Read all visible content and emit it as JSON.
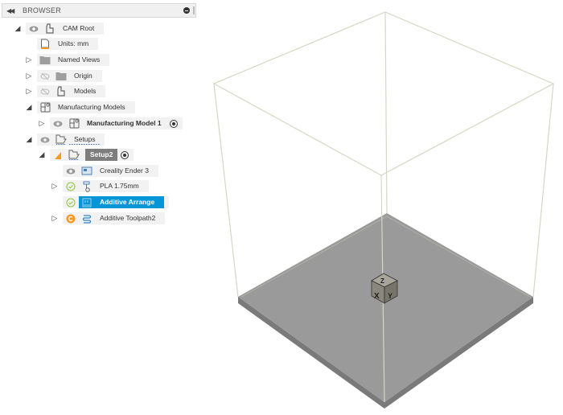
{
  "browser": {
    "title": "BROWSER",
    "collapse_icon": "double-chevron-left-icon",
    "tree": [
      {
        "label": "CAM Root",
        "expand": "expanded",
        "visibility": "visible",
        "icon": "component-icon"
      },
      {
        "label": "Units: mm",
        "expand": "none",
        "icon": "document-icon"
      },
      {
        "label": "Named Views",
        "expand": "collapsed",
        "icon": "folder-icon"
      },
      {
        "label": "Origin",
        "expand": "collapsed",
        "visibility": "hidden",
        "icon": "folder-icon"
      },
      {
        "label": "Models",
        "expand": "collapsed",
        "visibility": "hidden",
        "icon": "component-icon"
      },
      {
        "label": "Manufacturing Models",
        "expand": "expanded",
        "icon": "manufacturing-model-icon"
      },
      {
        "label": "Manufacturing Model 1",
        "expand": "collapsed",
        "visibility": "visible",
        "icon": "manufacturing-model-icon",
        "active": true
      },
      {
        "label": "Setups",
        "expand": "expanded",
        "visibility": "visible",
        "icon": "setups-icon"
      },
      {
        "label": "Setup2",
        "expand": "expanded",
        "icon": "setup-icon",
        "warning": true,
        "active": true
      },
      {
        "label": "Creality Ender 3",
        "expand": "none",
        "visibility": "visible",
        "icon": "machine-icon"
      },
      {
        "label": "PLA 1.75mm",
        "expand": "collapsed",
        "status": "ok",
        "icon": "print-setting-icon"
      },
      {
        "label": "Additive Arrange",
        "expand": "none",
        "status": "ok",
        "icon": "arrange-icon",
        "selected": true
      },
      {
        "label": "Additive Toolpath2",
        "expand": "collapsed",
        "status": "pending",
        "icon": "toolpath-icon"
      }
    ]
  },
  "viewport": {
    "build_volume": "printer-build-volume",
    "view_cube": {
      "faces": [
        "Z",
        "X",
        "Y"
      ]
    },
    "colors": {
      "frame": "#d6d6c4",
      "plate": "#9a9a9a",
      "plate_edge": "#7a7a7a",
      "selection": "#0696d7",
      "warning": "#f59a23"
    }
  }
}
